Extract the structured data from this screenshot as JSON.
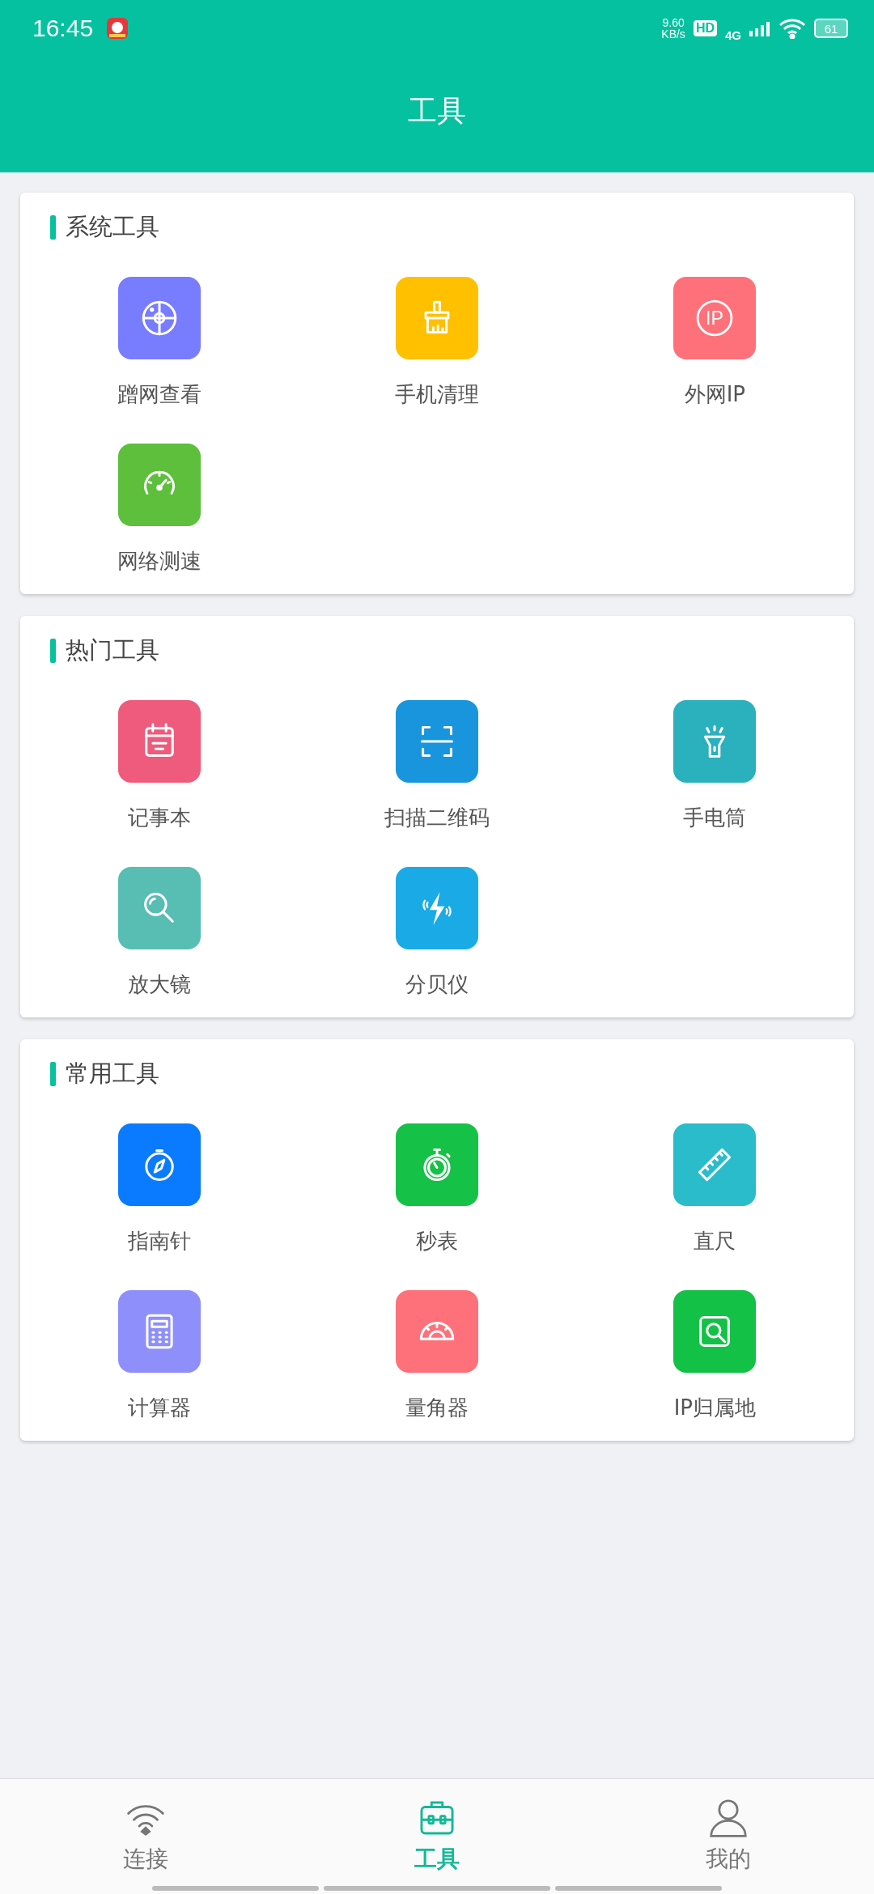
{
  "status_bar": {
    "time": "16:45",
    "speed_value": "9.60",
    "speed_unit": "KB/s",
    "hd": "HD",
    "network": "4G",
    "battery": "61"
  },
  "header": {
    "title": "工具"
  },
  "sections": [
    {
      "title": "系统工具",
      "tools": [
        {
          "label": "蹭网查看",
          "kind": "radar",
          "color": "#787cff"
        },
        {
          "label": "手机清理",
          "kind": "brush",
          "color": "#ffc000"
        },
        {
          "label": "外网IP",
          "kind": "ip",
          "color": "#ff717a",
          "icon_text": "IP"
        },
        {
          "label": "网络测速",
          "kind": "gauge",
          "color": "#5dbf3c"
        }
      ]
    },
    {
      "title": "热门工具",
      "tools": [
        {
          "label": "记事本",
          "kind": "notepad",
          "color": "#ee5b7c"
        },
        {
          "label": "扫描二维码",
          "kind": "scan",
          "color": "#1895dc"
        },
        {
          "label": "手电筒",
          "kind": "flashlight",
          "color": "#2bb1bd"
        },
        {
          "label": "放大镜",
          "kind": "magnifier",
          "color": "#58bdb3"
        },
        {
          "label": "分贝仪",
          "kind": "sound",
          "color": "#1aabe6"
        }
      ]
    },
    {
      "title": "常用工具",
      "tools": [
        {
          "label": "指南针",
          "kind": "compass",
          "color": "#0a7bff"
        },
        {
          "label": "秒表",
          "kind": "stopwatch",
          "color": "#15c146"
        },
        {
          "label": "直尺",
          "kind": "ruler",
          "color": "#2bbccb"
        },
        {
          "label": "计算器",
          "kind": "calculator",
          "color": "#8e8ffb"
        },
        {
          "label": "量角器",
          "kind": "protractor",
          "color": "#ff717a"
        },
        {
          "label": "IP归属地",
          "kind": "search-doc",
          "color": "#14c147"
        }
      ]
    }
  ],
  "tab_bar": [
    {
      "label": "连接",
      "kind": "wifi",
      "selected": false
    },
    {
      "label": "工具",
      "kind": "toolbox",
      "selected": true
    },
    {
      "label": "我的",
      "kind": "person",
      "selected": false
    }
  ]
}
